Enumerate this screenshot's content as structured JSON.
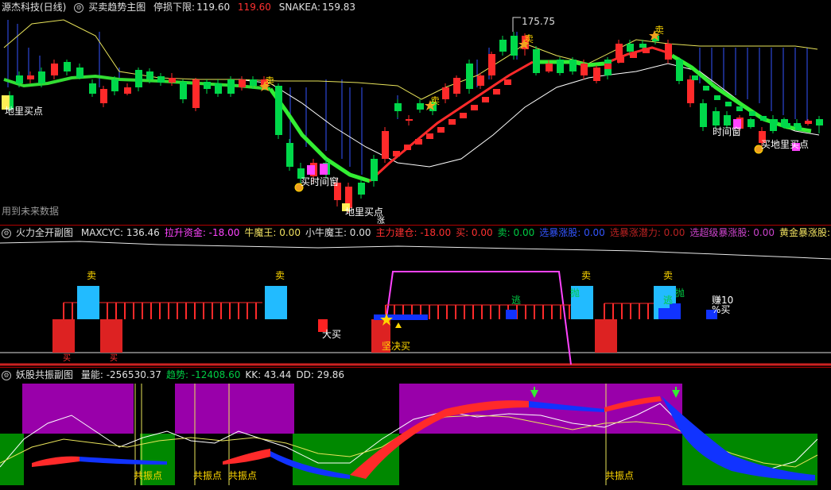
{
  "colors": {
    "up": "#ff2a2a",
    "down": "#00d84a",
    "yellow": "#e8e35a",
    "magenta": "#ff44ff",
    "cyan": "#22bbff",
    "blue": "#1133ff",
    "purple": "#9900aa",
    "green_zone": "#008800"
  },
  "main": {
    "title": "源杰科技(日线)",
    "indicator_name": "买卖趋势主图",
    "stop_label": "停损下限:",
    "stop_value": "119.60",
    "stop_value2": "119.60",
    "snake_label": "SNAKEA:",
    "snake_value": "159.83",
    "high_marker": "175.75",
    "future_note": "用到未来数据",
    "annotations": {
      "buy_point_left": "地里买点",
      "buy_window_1": "买时间窗",
      "buy_point_bottom": "地里买点",
      "bottom_zhang": "涨",
      "time_window_right": "时间窗",
      "buy_point_right": "买地里买点",
      "sell_1": "卖",
      "sell_2": "卖",
      "sell_3": "卖",
      "sell_4": "卖"
    }
  },
  "fire": {
    "indicator_name": "火力全开副图",
    "items": [
      {
        "label": "MAXCYC:",
        "value": "136.46",
        "color": "#e0e0e0"
      },
      {
        "label": "拉升资金:",
        "value": "-18.00",
        "color": "#ff44ff"
      },
      {
        "label": "牛魔王:",
        "value": "0.00",
        "color": "#f0e060"
      },
      {
        "label": "小牛魔王:",
        "value": "0.00",
        "color": "#e0e0e0"
      },
      {
        "label": "主力建仓:",
        "value": "-18.00",
        "color": "#ff3030"
      },
      {
        "label": "买:",
        "value": "0.00",
        "color": "#ff3030"
      },
      {
        "label": "卖:",
        "value": "0.00",
        "color": "#00cc44"
      },
      {
        "label": "选暴涨股:",
        "value": "0.00",
        "color": "#3355ff"
      },
      {
        "label": "选暴涨潜力:",
        "value": "0.00",
        "color": "#bb2222"
      },
      {
        "label": "选超级暴涨股:",
        "value": "0.00",
        "color": "#cc44cc"
      },
      {
        "label": "黄金暴涨股:",
        "value": "0.00",
        "color": "#f0e060"
      },
      {
        "label": "坚决买",
        "value": "",
        "color": "#ff44ff"
      }
    ],
    "annotations": {
      "sell": "卖",
      "escape": "逃",
      "throw": "抛",
      "big_buy": "大买",
      "firm_buy": "坚决买",
      "buy": "买",
      "profit": "赚10",
      "sell_small": "%买"
    }
  },
  "resonance": {
    "indicator_name": "妖股共振副图",
    "items": [
      {
        "label": "量能:",
        "value": "-256530.37",
        "color": "#e0e0e0"
      },
      {
        "label": "趋势:",
        "value": "-12408.60",
        "color": "#00cc44"
      },
      {
        "label": "KK:",
        "value": "43.44",
        "color": "#e0e0e0"
      },
      {
        "label": "DD:",
        "value": "29.86",
        "color": "#e0e0e0"
      }
    ],
    "resonance_label": "共振点"
  }
}
